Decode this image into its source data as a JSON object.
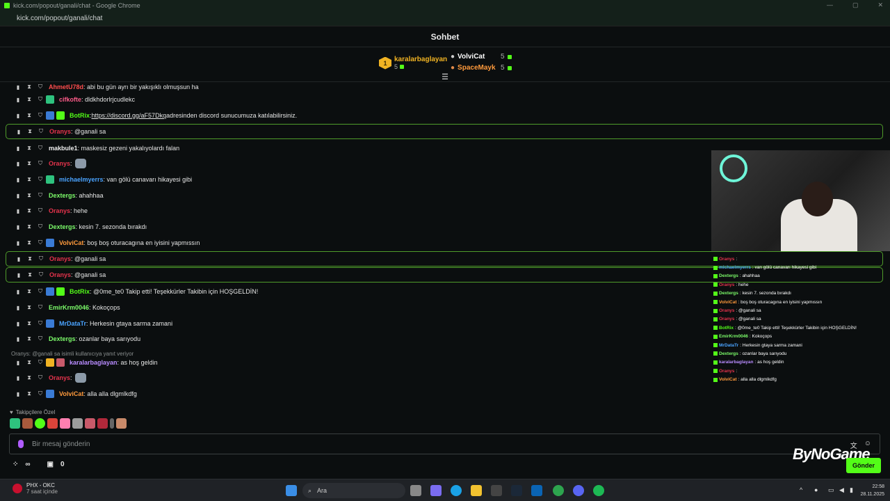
{
  "window": {
    "title": "kick.com/popout/ganali/chat - Google Chrome",
    "url": "kick.com/popout/ganali/chat"
  },
  "header": {
    "title": "Sohbet"
  },
  "leaderboard": {
    "first": {
      "rank": "1",
      "name": "karalarbaglayan",
      "count": "5"
    },
    "second": {
      "name": "VolviCat",
      "count": "5"
    },
    "third": {
      "name": "SpaceMayk",
      "count": "5"
    }
  },
  "messages": [
    {
      "user": "AhmetU78d",
      "text": ": abi bu gün ayrı bir yakışıklı olmuşsun ha",
      "color": "#ff4d4d"
    },
    {
      "user": "cifkofte",
      "text": ": dldkhdorlrjcudlekc",
      "color": "#ff5c8a"
    },
    {
      "user": "BotRix",
      "text": "adresinden discord sunucumuza katılabilirsiniz.",
      "link": "https://discord.gg/aF57Dkq",
      "color": "#53fc18"
    },
    {
      "user": "Oranys",
      "text": ": @ganali sa",
      "color": "#e5334c"
    },
    {
      "user": "makbule1",
      "text": ": maskesiz gezeni yakalıyolardı falan",
      "color": "#f0f0f0"
    },
    {
      "user": "Oranys",
      "text": ":",
      "color": "#e5334c"
    },
    {
      "user": "michaelmyerrs",
      "text": ": van gölü canavarı hikayesi gibi",
      "color": "#4aa3ff"
    },
    {
      "user": "Dextergs",
      "text": ": ahahhaa",
      "color": "#7cfc6a"
    },
    {
      "user": "Oranys",
      "text": ": hehe",
      "color": "#e5334c"
    },
    {
      "user": "Dextergs",
      "text": ": kesin 7. sezonda bırakdı",
      "color": "#7cfc6a"
    },
    {
      "user": "VolviCat",
      "text": ": boş boş oturacagına en iyisini yapmıssın",
      "color": "#ff9a3c"
    },
    {
      "user": "Oranys",
      "text": ": @ganali sa",
      "color": "#e5334c"
    },
    {
      "user": "Oranys",
      "text": ": @ganali sa",
      "color": "#e5334c"
    },
    {
      "user": "BotRix",
      "text": ": @0me_te0 Takip etti! Teşekkürler Takibin için HOŞGELDİN!",
      "color": "#53fc18"
    },
    {
      "user": "EmirKrm0046",
      "text": ": Kokoçops",
      "color": "#7cfc6a"
    },
    {
      "user": "MrDataTr",
      "text": ": Herkesin gtaya sarma zamani",
      "color": "#4aa3ff"
    },
    {
      "user": "Dextergs",
      "text": ": ozanlar baya sarıyodu",
      "color": "#7cfc6a"
    },
    {
      "user": "karalarbaglayan",
      "text": ": as hoş geldin",
      "color": "#b98cff"
    },
    {
      "user": "Oranys",
      "text": ":",
      "color": "#e5334c"
    },
    {
      "user": "VolviCat",
      "text": ": alla alla dlgmlkdfg",
      "color": "#ff9a3c"
    }
  ],
  "reply_note": "Oranys: @ganali sa isimli kullanıcıya yanıt veriyor",
  "overlay": [
    {
      "user": "Oranys",
      "text": ":"
    },
    {
      "user": "michaelmyerrs",
      "text": ": van gölü canavarı hikayesi gibi"
    },
    {
      "user": "Dextergs",
      "text": ": ahahhaa"
    },
    {
      "user": "Oranys",
      "text": ": hehe"
    },
    {
      "user": "Dextergs",
      "text": ": kesin 7. sezonda bırakdı"
    },
    {
      "user": "VolviCat",
      "text": ": boş boş oturacagına en iyisini yapmıssın"
    },
    {
      "user": "Oranys",
      "text": ": @ganali sa"
    },
    {
      "user": "Oranys",
      "text": ": @ganali sa"
    },
    {
      "user": "BotRix",
      "text": ": @0me_te0 Takip etti! Teşekkürler Takibin için HOŞGELDİN!"
    },
    {
      "user": "EmirKrm0046",
      "text": ": Kokoçops"
    },
    {
      "user": "MrDataTr",
      "text": ": Herkesin gtaya sarma zamani"
    },
    {
      "user": "Dextergs",
      "text": ": ozanlar baya sarıyodu"
    },
    {
      "user": "karalarbaglayan",
      "text": ": as hoş geldin"
    },
    {
      "user": "Oranys",
      "text": ":"
    },
    {
      "user": "VolviCat",
      "text": ": alla alla dlgmlkdfg"
    }
  ],
  "followers_label": "Takipçilere Özel",
  "input": {
    "placeholder": "Bir mesaj gönderin",
    "send_label": "Gönder"
  },
  "bottom": {
    "count": "0"
  },
  "brand": "ByNoGame",
  "taskbar": {
    "weather_title": "PHX - OKC",
    "weather_sub": "7 saat içinde",
    "search": "Ara",
    "time": "22:58",
    "date": "28.11.2025"
  }
}
